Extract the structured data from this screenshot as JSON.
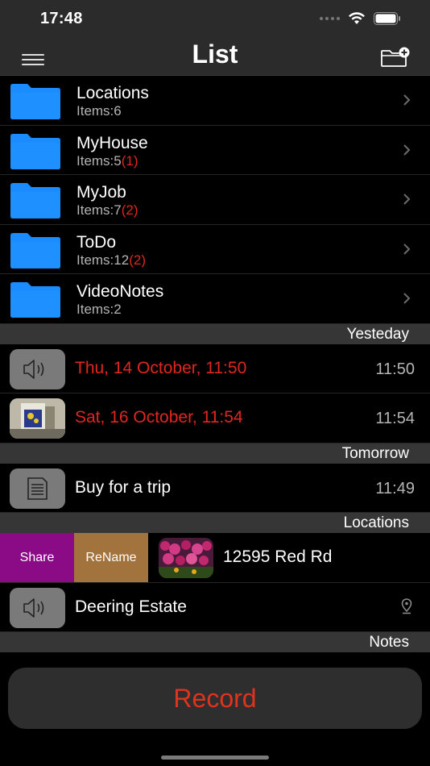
{
  "status": {
    "time": "17:48"
  },
  "nav": {
    "title": "List"
  },
  "folders": [
    {
      "name": "Locations",
      "count": "Items:6",
      "extra": ""
    },
    {
      "name": "MyHouse",
      "count": "Items:5",
      "extra": "(1)"
    },
    {
      "name": "MyJob",
      "count": "Items:7",
      "extra": "(2)"
    },
    {
      "name": "ToDo",
      "count": "Items:12",
      "extra": "(2)"
    },
    {
      "name": "VideoNotes",
      "count": "Items:2",
      "extra": ""
    }
  ],
  "sections": {
    "yesterday": {
      "title": "Yesteday",
      "items": [
        {
          "title": "Thu, 14 October, 11:50",
          "time": "11:50",
          "icon": "speaker-icon"
        },
        {
          "title": "Sat, 16 October, 11:54",
          "time": "11:54",
          "icon": "photo-thumbnail"
        }
      ]
    },
    "tomorrow": {
      "title": "Tomorrow",
      "items": [
        {
          "title": "Buy for a trip",
          "time": "11:49",
          "icon": "document-icon"
        }
      ]
    },
    "locations": {
      "title": "Locations",
      "swipe_item": {
        "title": "12595 Red Rd",
        "share_label": "Share",
        "rename_label": "ReName"
      },
      "items": [
        {
          "title": "Deering Estate",
          "icon": "speaker-icon",
          "trailing": "location-pin-icon"
        }
      ]
    },
    "notes": {
      "title": "Notes"
    }
  },
  "record": {
    "label": "Record"
  },
  "colors": {
    "accent_red": "#e0261f",
    "folder_blue": "#1a8cff",
    "share": "#8b0a86",
    "rename": "#a3733e"
  }
}
